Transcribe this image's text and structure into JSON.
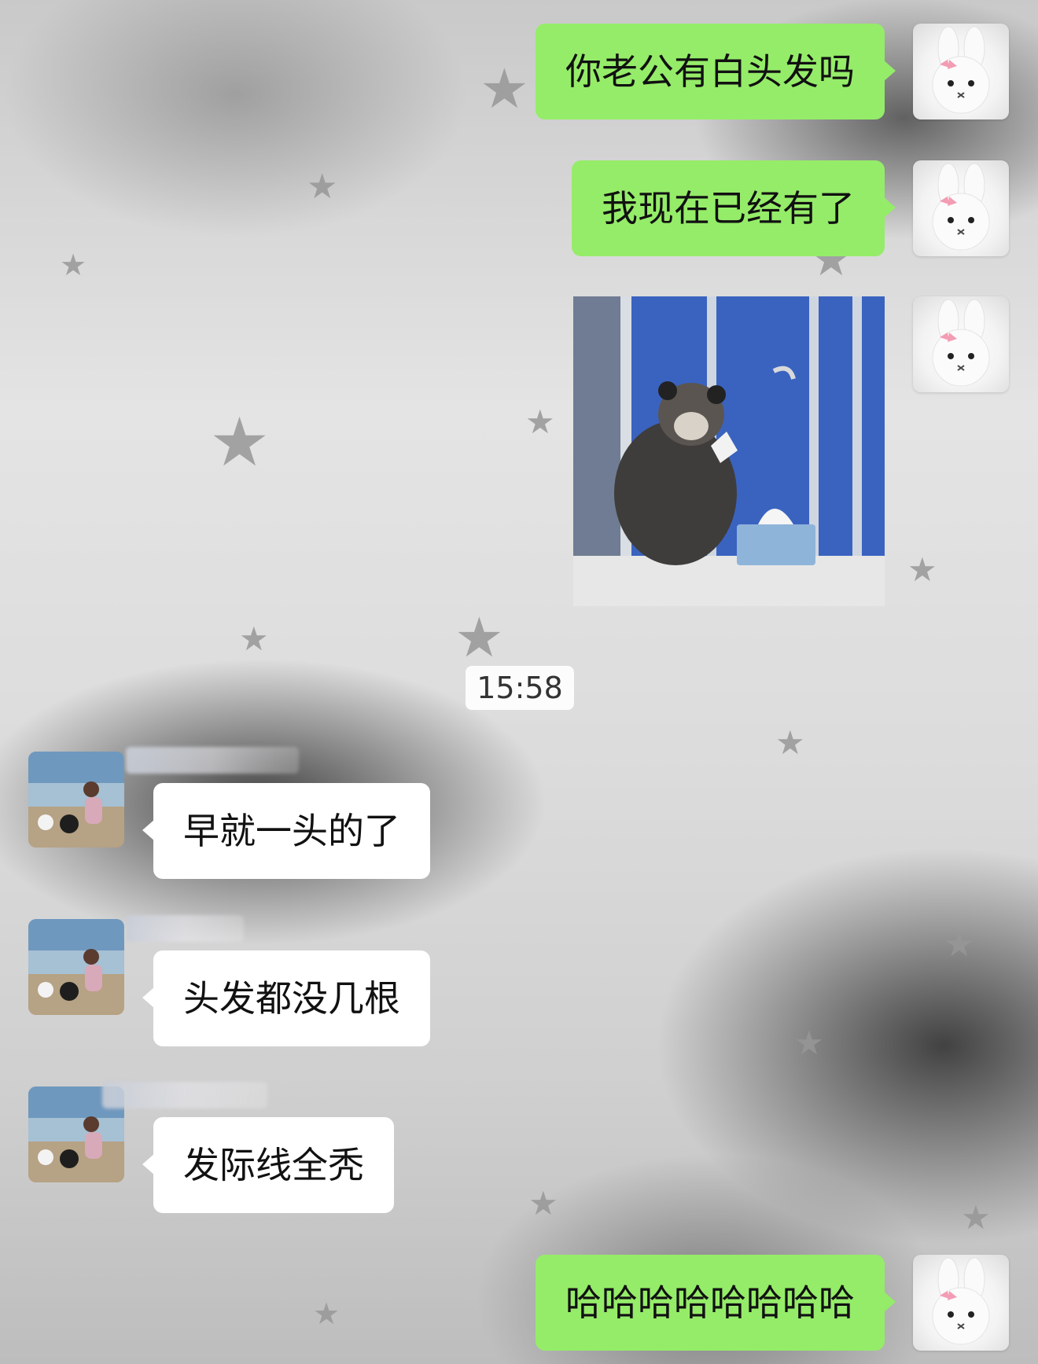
{
  "messages": [
    {
      "side": "sent",
      "text": "你老公有白头发吗"
    },
    {
      "side": "sent",
      "text": "我现在已经有了"
    },
    {
      "side": "sent",
      "type": "image"
    },
    {
      "side": "recv",
      "text": "早就一头的了"
    },
    {
      "side": "recv",
      "text": "头发都没几根"
    },
    {
      "side": "recv",
      "text": "发际线全秃"
    },
    {
      "side": "sent",
      "text": "哈哈哈哈哈哈哈哈"
    }
  ],
  "timestamp": "15:58",
  "colors": {
    "sent_bubble": "#95ec69",
    "recv_bubble": "#ffffff"
  },
  "icons": {
    "my_avatar": "bunny-plush-icon",
    "their_avatar": "beach-photo-avatar"
  }
}
